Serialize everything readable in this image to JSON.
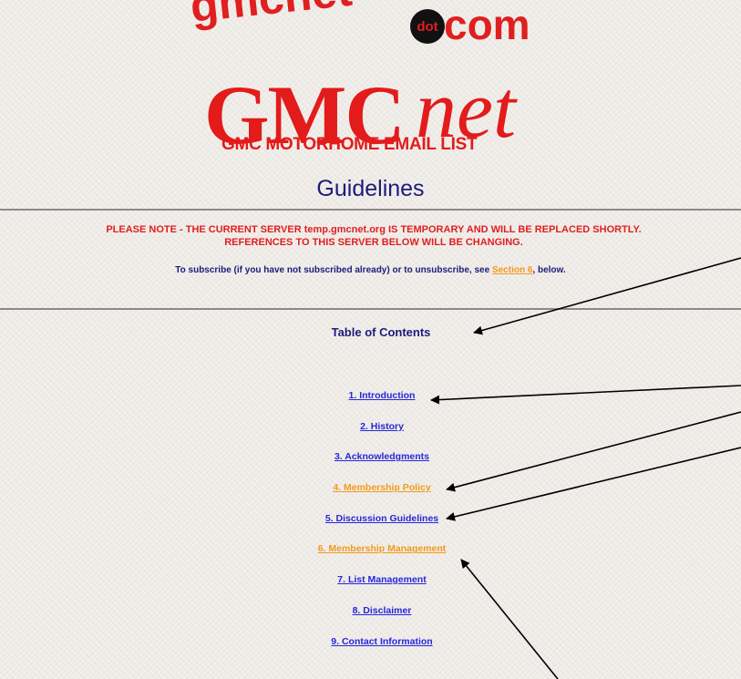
{
  "banner": {
    "left_text": "gmcnet",
    "dot_text": "dot",
    "right_text": "com"
  },
  "logo": {
    "main": "GMC",
    "accent": "net",
    "subtitle": "GMC MOTORHOME EMAIL LIST"
  },
  "page_title": "Guidelines",
  "notice": {
    "line1": "PLEASE NOTE - THE CURRENT SERVER temp.gmcnet.org IS TEMPORARY AND WILL BE REPLACED SHORTLY.",
    "line2": "REFERENCES TO THIS SERVER BELOW WILL BE CHANGING."
  },
  "subscribe": {
    "before": "To subscribe (if you have not subscribed already) or to unsubscribe, see ",
    "link": "Section 6",
    "after": ", below."
  },
  "toc": {
    "heading": "Table of Contents",
    "items": [
      {
        "label": "1. Introduction",
        "visited": false
      },
      {
        "label": "2. History",
        "visited": false
      },
      {
        "label": "3. Acknowledgments",
        "visited": false
      },
      {
        "label": "4. Membership Policy",
        "visited": true
      },
      {
        "label": "5. Discussion Guidelines",
        "visited": false
      },
      {
        "label": "6. Membership Management",
        "visited": true
      },
      {
        "label": "7. List Management",
        "visited": false
      },
      {
        "label": "8. Disclaimer",
        "visited": false
      },
      {
        "label": "9. Contact Information",
        "visited": false
      }
    ]
  },
  "colors": {
    "brand_red": "#e31b1b",
    "link_blue": "#2727d8",
    "visited_orange": "#f29a1a",
    "heading_navy": "#1c1c7a"
  }
}
